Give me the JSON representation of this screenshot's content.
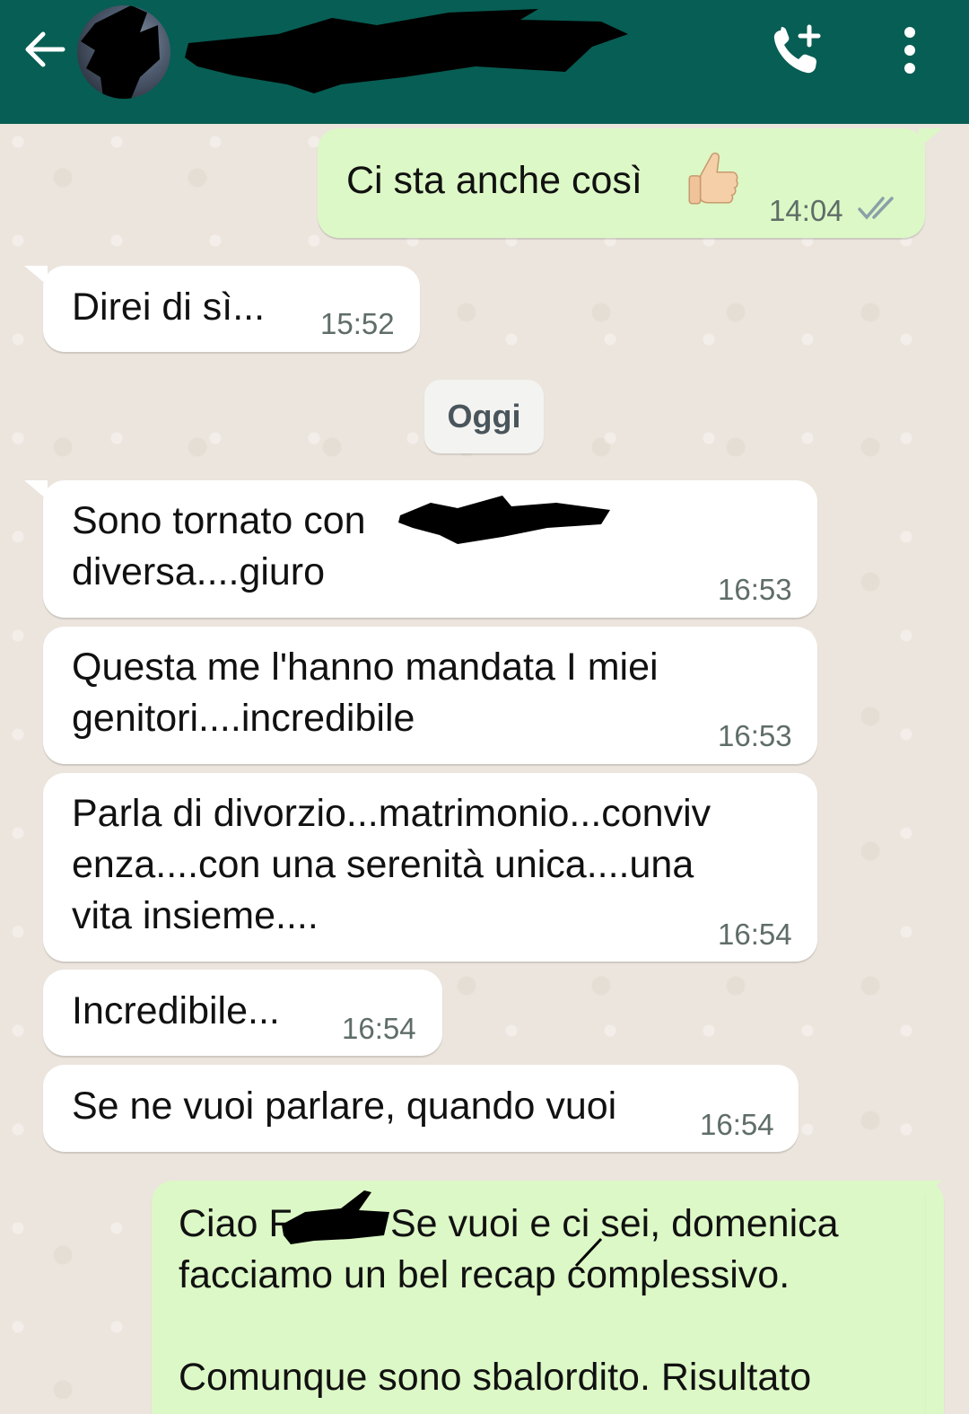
{
  "header": {
    "back_icon": "arrow-left-icon",
    "add_call_icon": "phone-plus-icon",
    "menu_icon": "more-vert-icon",
    "bar_color": "#075e54"
  },
  "colors": {
    "incoming_bubble": "#ffffff",
    "outgoing_bubble": "#dcf8c6",
    "chat_background": "#ece5dd",
    "read_ticks": "#8aa0a8"
  },
  "messages": [
    {
      "direction": "out",
      "text": "Ci sta anche così",
      "emoji": "thumbs-up",
      "time": "14:04",
      "status": "read"
    },
    {
      "direction": "in",
      "text": "Direi di sì...",
      "time": "15:52"
    },
    {
      "direction": "in",
      "text": "Sono tornato con\ndiversa....giuro",
      "time": "16:53"
    },
    {
      "direction": "in",
      "text": "Questa me l'hanno mandata I miei\ngenitori....incredibile",
      "time": "16:53"
    },
    {
      "direction": "in",
      "text": "Parla di divorzio...matrimonio...conviv\nenza....con una serenità unica....una\nvita insieme....",
      "time": "16:54"
    },
    {
      "direction": "in",
      "text": "Incredibile...",
      "time": "16:54"
    },
    {
      "direction": "in",
      "text": "Se ne vuoi parlare, quando vuoi",
      "time": "16:54"
    },
    {
      "direction": "out",
      "text_line1_prefix": "Ciao F",
      "text_line1_suffix": "Se vuoi e ci sei, domenica",
      "text_line2": "facciamo un bel recap complessivo.",
      "text_line3": "Comunque sono sbalordito. Risultato"
    }
  ],
  "date_separator": "Oggi"
}
